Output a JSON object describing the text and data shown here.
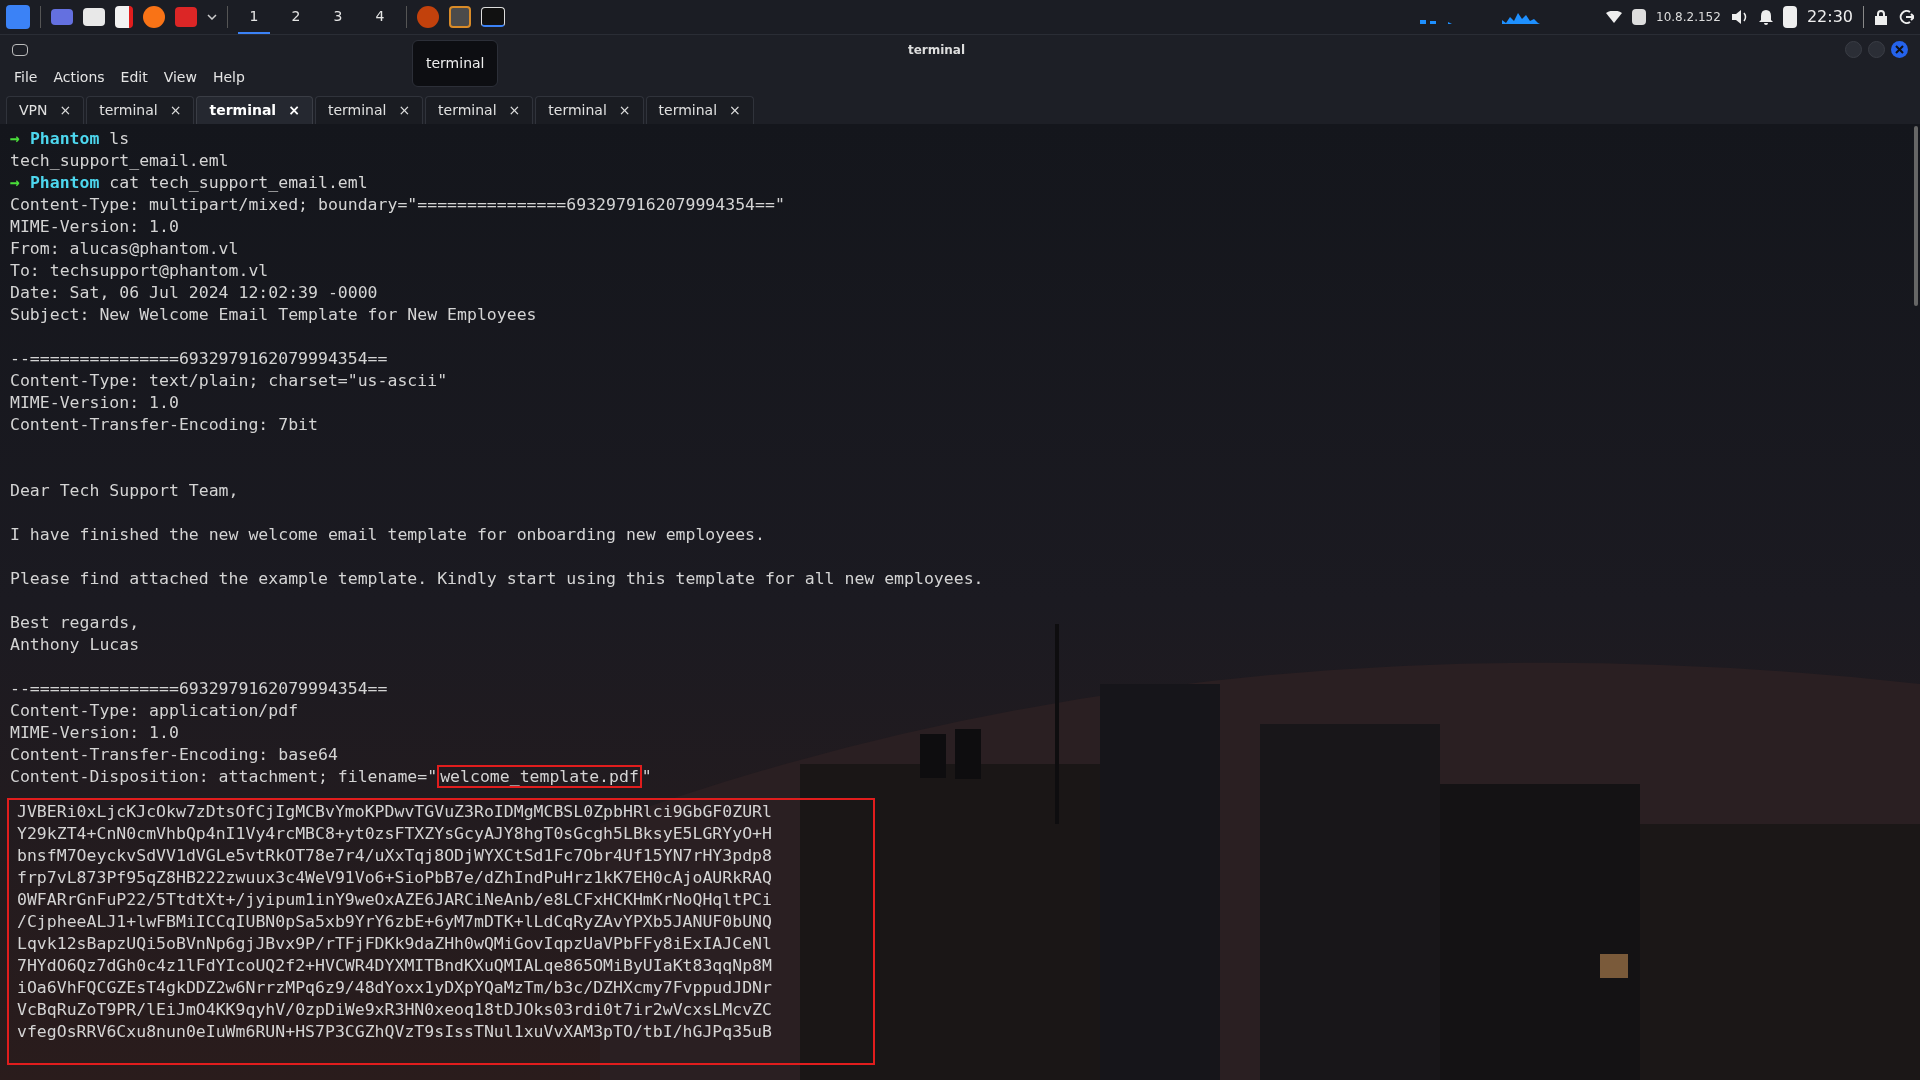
{
  "taskbar": {
    "workspaces": [
      {
        "label": "1",
        "selected": true
      },
      {
        "label": "2",
        "selected": false
      },
      {
        "label": "3",
        "selected": false
      },
      {
        "label": "4",
        "selected": false
      }
    ],
    "ip": "10.8.2.152",
    "clock": "22:30"
  },
  "window": {
    "title": "terminal",
    "tooltip": "terminal"
  },
  "menu": [
    "File",
    "Actions",
    "Edit",
    "View",
    "Help"
  ],
  "tabs": [
    {
      "label": "VPN",
      "selected": false
    },
    {
      "label": "terminal",
      "selected": false
    },
    {
      "label": "terminal",
      "selected": true
    },
    {
      "label": "terminal",
      "selected": false
    },
    {
      "label": "terminal",
      "selected": false
    },
    {
      "label": "terminal",
      "selected": false
    },
    {
      "label": "terminal",
      "selected": false
    }
  ],
  "close_glyph": "×",
  "terminal": {
    "lines": [
      {
        "kind": "prompt",
        "symbol": "→",
        "user": "Phantom",
        "command": "ls"
      },
      {
        "kind": "output",
        "text": "tech_support_email.eml"
      },
      {
        "kind": "prompt",
        "symbol": "→",
        "user": "Phantom",
        "command": "cat tech_support_email.eml"
      },
      {
        "kind": "output",
        "text": "Content-Type: multipart/mixed; boundary=\"===============6932979162079994354==\""
      },
      {
        "kind": "output",
        "text": "MIME-Version: 1.0"
      },
      {
        "kind": "output",
        "text": "From: alucas@phantom.vl"
      },
      {
        "kind": "output",
        "text": "To: techsupport@phantom.vl"
      },
      {
        "kind": "output",
        "text": "Date: Sat, 06 Jul 2024 12:02:39 -0000"
      },
      {
        "kind": "output",
        "text": "Subject: New Welcome Email Template for New Employees"
      },
      {
        "kind": "blank"
      },
      {
        "kind": "output",
        "text": "--===============6932979162079994354=="
      },
      {
        "kind": "output",
        "text": "Content-Type: text/plain; charset=\"us-ascii\""
      },
      {
        "kind": "output",
        "text": "MIME-Version: 1.0"
      },
      {
        "kind": "output",
        "text": "Content-Transfer-Encoding: 7bit"
      },
      {
        "kind": "blank"
      },
      {
        "kind": "blank"
      },
      {
        "kind": "output",
        "text": "Dear Tech Support Team,"
      },
      {
        "kind": "blank"
      },
      {
        "kind": "output",
        "text": "I have finished the new welcome email template for onboarding new employees."
      },
      {
        "kind": "blank"
      },
      {
        "kind": "output",
        "text": "Please find attached the example template. Kindly start using this template for all new employees."
      },
      {
        "kind": "blank"
      },
      {
        "kind": "output",
        "text": "Best regards,"
      },
      {
        "kind": "output",
        "text": "Anthony Lucas"
      },
      {
        "kind": "blank"
      },
      {
        "kind": "output",
        "text": "--===============6932979162079994354=="
      },
      {
        "kind": "output",
        "text": "Content-Type: application/pdf"
      },
      {
        "kind": "output",
        "text": "MIME-Version: 1.0"
      },
      {
        "kind": "output",
        "text": "Content-Transfer-Encoding: base64"
      },
      {
        "kind": "highlight",
        "before": "Content-Disposition: attachment; filename=\"",
        "highlight": "welcome_template.pdf",
        "after": "\""
      },
      {
        "kind": "boxed",
        "lines": [
          "JVBERi0xLjcKJcOkw7zDtsOfCjIgMCBvYmoKPDwvTGVuZ3RoIDMgMCBSL0ZpbHRlci9GbGF0ZURl",
          "Y29kZT4+CnN0cmVhbQp4nI1Vy4rcMBC8+yt0zsFTXZYsGcyAJY8hgT0sGcgh5LBksyE5LGRYyO+H",
          "bnsfM7OeyckvSdVV1dVGLe5vtRkOT78e7r4/uXxTqj8ODjWYXCtSd1Fc7Obr4Uf15YN7rHY3pdp8",
          "frp7vL873Pf95qZ8HB222zwuux3c4WeV91Vo6+SioPbB7e/dZhIndPuHrz1kK7EH0cAjoAURkRAQ",
          "0WFARrGnFuP22/5TtdtXt+/jyipum1inY9weOxAZE6JARCiNeAnb/e8LCFxHCKHmKrNoQHqltPCi",
          "/CjpheeALJ1+lwFBMiICCqIUBN0pSa5xb9YrY6zbE+6yM7mDTK+lLdCqRyZAvYPXb5JANUF0bUNQ",
          "Lqvk12sBapzUQi5oBVnNp6gjJBvx9P/rTFjFDKk9daZHh0wQMiGovIqpzUaVPbFFy8iExIAJCeNl",
          "7HYdO6Qz7dGh0c4z1lFdYIcoUQ2f2+HVCWR4DYXMITBndKXuQMIALqe865OMiByUIaKt83qqNp8M",
          "iOa6VhFQCGZEsT4gkDDZ2w6NrrzMPq6z9/48dYoxx1yDXpYQaMzTm/b3c/DZHXcmy7FvppudJDNr",
          "VcBqRuZoT9PR/lEiJmO4KK9qyhV/0zpDiWe9xR3HN0xeoq18tDJOks03rdi0t7ir2wVcxsLMcvZC",
          "vfegOsRRV6Cxu8nun0eIuWm6RUN+HS7P3CGZhQVzT9sIssTNul1xuVvXAM3pTO/tbI/hGJPq35uB"
        ]
      }
    ]
  }
}
